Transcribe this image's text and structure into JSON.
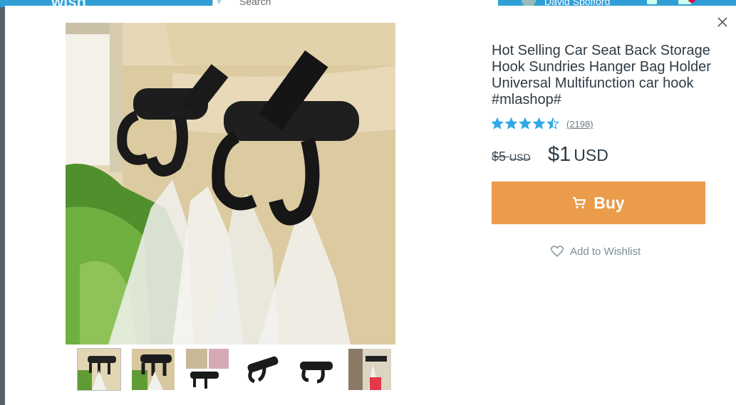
{
  "background": {
    "logo": "wish",
    "search_placeholder": "Search",
    "user_name": "David Spofford"
  },
  "product": {
    "title": "Hot Selling Car Seat Back Storage Hook Sundries Hanger Bag Holder Universal Multifunction car hook #mlashop#",
    "rating_stars": 4.5,
    "rating_count": "(2198)",
    "old_price": "$5",
    "old_price_unit": "USD",
    "price": "$1",
    "price_unit": "USD",
    "buy_label": "Buy",
    "wishlist_label": "Add to Wishlist",
    "thumbnail_count": 6
  },
  "colors": {
    "accent_buy": "#ea9c4b",
    "star": "#2fa8e6",
    "header": "#2f9fd6"
  },
  "icons": {
    "close": "close-icon",
    "cart": "cart-icon",
    "heart": "heart-icon",
    "star": "star-icon"
  }
}
